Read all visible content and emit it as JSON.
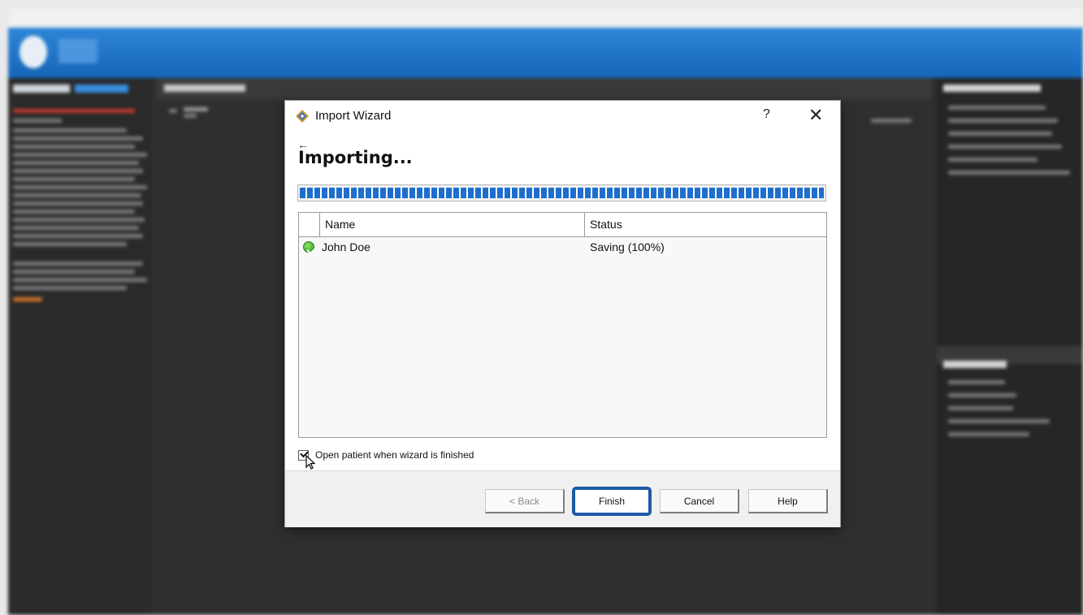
{
  "dialog": {
    "title": "Import Wizard",
    "help_glyph": "?",
    "close_glyph": "✕",
    "back_arrow_glyph": "←",
    "heading": "Importing...",
    "progress_percent": 100,
    "list": {
      "columns": {
        "name": "Name",
        "status": "Status"
      },
      "rows": [
        {
          "icon": "green-check-icon",
          "name": "John Doe",
          "status": "Saving (100%)"
        }
      ]
    },
    "open_patient": {
      "label": "Open patient when wizard is finished",
      "checked": true
    },
    "buttons": {
      "back": "< Back",
      "finish": "Finish",
      "cancel": "Cancel",
      "help": "Help"
    }
  },
  "colors": {
    "app_header": "#1e72c4",
    "progress": "#1e6ecf",
    "finish_focus": "#1c5aa8",
    "success_icon": "#3aa824"
  }
}
